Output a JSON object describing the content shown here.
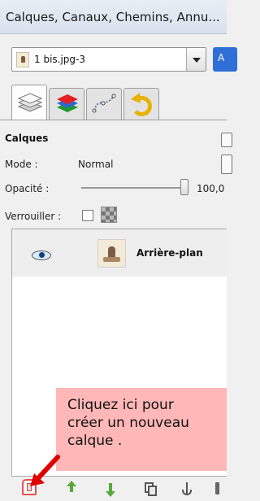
{
  "window": {
    "title": "Calques, Canaux, Chemins, Annu..."
  },
  "image_selector": {
    "value": "1 bis.jpg-3",
    "auto_label": "A"
  },
  "tabs": [
    {
      "name": "layers",
      "icon": "layers-icon"
    },
    {
      "name": "channels",
      "icon": "channels-icon"
    },
    {
      "name": "paths",
      "icon": "paths-icon"
    },
    {
      "name": "undo",
      "icon": "undo-icon"
    }
  ],
  "layers": {
    "section_title": "Calques",
    "mode_label": "Mode :",
    "mode_value": "Normal",
    "opacity_label": "Opacité :",
    "opacity_value": "100,0",
    "opacity_percent": 100,
    "lock_label": "Verrouiller :"
  },
  "layer_list": [
    {
      "name": "Arrière-plan",
      "visible": true
    }
  ],
  "callout": {
    "line1": "Cliquez ici pour",
    "line2": "créer un nouveau",
    "line3": "calque ."
  },
  "toolbar": {
    "new_layer_icon": "new-layer-icon",
    "raise_icon": "raise-layer-icon",
    "lower_icon": "lower-layer-icon",
    "duplicate_icon": "duplicate-layer-icon",
    "anchor_icon": "anchor-layer-icon",
    "more_icon": "more-icon"
  },
  "colors": {
    "callout_bg": "#ffb7b7",
    "arrow_red": "#e00000",
    "selected_row": "#eeeeee"
  }
}
